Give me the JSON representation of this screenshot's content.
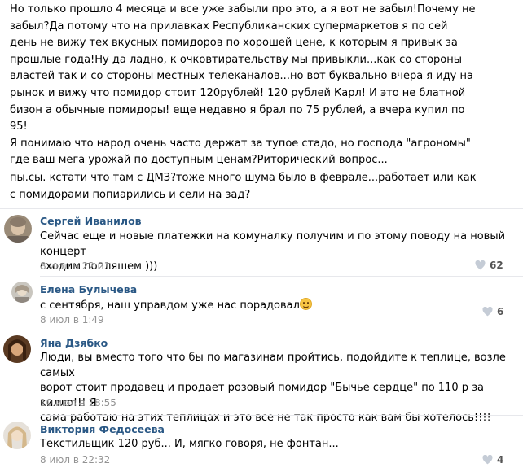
{
  "post": {
    "main_lines": [
      "Но только прошло 4 месяца и все уже забыли про это, а я вот не забыл!Почему не",
      "забыл?Да потому что на прилавках Республиканских супермаркетов я по сей",
      "день не вижу тех вкусных помидоров по хорошей цене, к которым я привык за",
      "прошлые года!Ну да ладно, к очковтирательству мы привыкли...как со стороны",
      "властей так и со стороны местных телеканалов...но вот буквально вчера я иду на",
      "рынок и вижу что помидор стоит 120рублей! 120 рублей Карл! И это не блатной",
      "бизон а обычные помидоры! еще недавно я брал по 75 рублей, а вчера купил по",
      "95!",
      "Я понимаю что народ очень часто держат за тупое стадо, но господа \"агрономы\"",
      "где ваш мега урожай по доступным ценам?Риторический вопрос..."
    ],
    "ps_lines": [
      "пы.сы. кстати что там с ДМЗ?тоже много шума было в феврале...работает или как",
      "с помидорами попиарились и сели на зад?"
    ]
  },
  "comments": [
    {
      "author": "Сергей Иванилов",
      "text_lines": [
        "Сейчас еще и новые платежки на комуналку получим и по этому поводу на новый концерт",
        "сходим попляшем )))"
      ],
      "date": "8 июл в 22:21",
      "likes": "62"
    },
    {
      "author": "Елена Булычева",
      "text_lines": [
        "с сентября, наш управдом уже нас порадовал"
      ],
      "date": "8 июл в 1:49",
      "likes": "6"
    },
    {
      "author": "Яна Дзябко",
      "text_lines": [
        "Люди, вы вместо того что бы по магазинам пройтись, подойдите к теплице, возле самых",
        "ворот стоит продавец и продает розовый помидор \"Бычье сердце\" по 110 р за килло!!! Я",
        "сама работаю на этих теплицах и это все не так просто как вам бы хотелось!!!!"
      ],
      "date": "10 июл в 18:55",
      "likes": ""
    },
    {
      "author": "Виктория Федосеева",
      "text_lines": [
        "Текстильщик 120 руб... И, мягко говоря, не фонтан..."
      ],
      "date": "8 июл в 22:32",
      "likes": "4"
    }
  ],
  "colors": {
    "author_link": "#2a5885",
    "date": "#939393",
    "divider": "#e7e8ec"
  }
}
